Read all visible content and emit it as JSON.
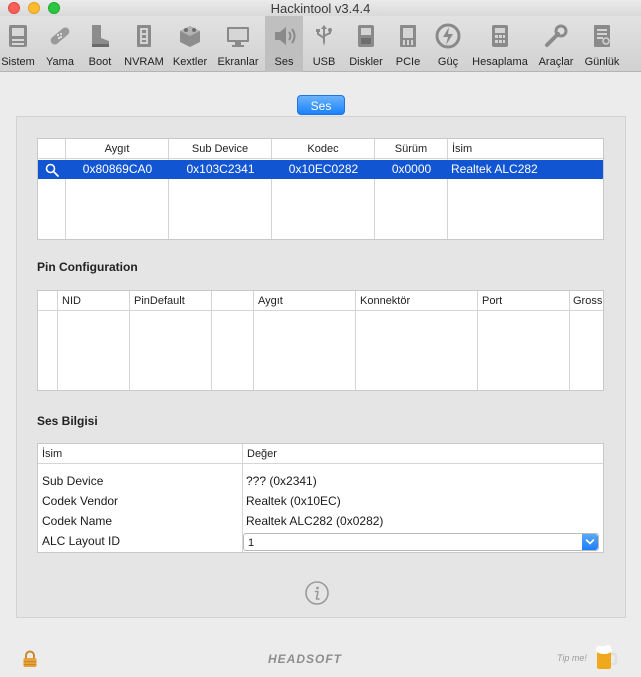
{
  "window": {
    "title": "Hackintool v3.4.4"
  },
  "toolbar": {
    "items": [
      {
        "label": "Sistem",
        "icon": "system-icon"
      },
      {
        "label": "Yama",
        "icon": "patch-icon"
      },
      {
        "label": "Boot",
        "icon": "boot-icon"
      },
      {
        "label": "NVRAM",
        "icon": "nvram-icon"
      },
      {
        "label": "Kextler",
        "icon": "kext-icon"
      },
      {
        "label": "Ekranlar",
        "icon": "display-icon"
      },
      {
        "label": "Ses",
        "icon": "speaker-icon"
      },
      {
        "label": "USB",
        "icon": "usb-icon"
      },
      {
        "label": "Diskler",
        "icon": "disk-icon"
      },
      {
        "label": "PCIe",
        "icon": "pcie-icon"
      },
      {
        "label": "Güç",
        "icon": "power-icon"
      },
      {
        "label": "Hesaplama",
        "icon": "calculator-icon"
      },
      {
        "label": "Araçlar",
        "icon": "tools-icon"
      },
      {
        "label": "Günlük",
        "icon": "log-icon"
      }
    ],
    "active": "Ses"
  },
  "segment": {
    "label": "Ses"
  },
  "device_table": {
    "columns": [
      "Aygıt",
      "Sub Device",
      "Kodec",
      "Sürüm",
      "İsim"
    ],
    "rows": [
      {
        "device": "0x80869CA0",
        "sub_device": "0x103C2341",
        "codec": "0x10EC0282",
        "version": "0x0000",
        "name": "Realtek ALC282"
      }
    ]
  },
  "pin_config": {
    "title": "Pin Configuration",
    "columns": [
      "NID",
      "PinDefault",
      "",
      "Aygıt",
      "Konnektör",
      "Port",
      "Gross"
    ]
  },
  "audio_info": {
    "title": "Ses Bilgisi",
    "columns": [
      "İsim",
      "Değer"
    ],
    "rows": [
      {
        "key": "Sub Device",
        "value": "??? (0x2341)"
      },
      {
        "key": "Codek Vendor",
        "value": "Realtek (0x10EC)"
      },
      {
        "key": "Codek Name",
        "value": "Realtek ALC282 (0x0282)"
      },
      {
        "key": "ALC Layout ID",
        "value": "1"
      }
    ]
  },
  "footer": {
    "brand": "HEADSOFT",
    "tip": "Tip me!"
  },
  "colors": {
    "selection": "#1155d3",
    "accent": "#1a82fb"
  }
}
